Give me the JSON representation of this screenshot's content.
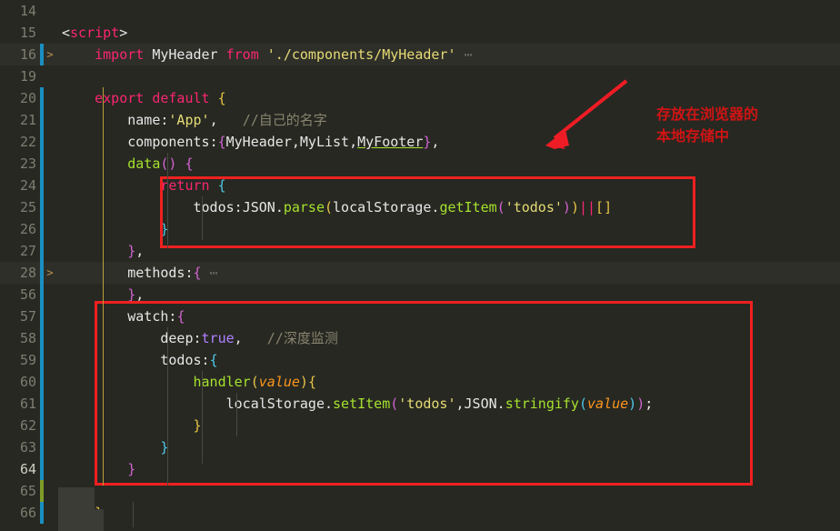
{
  "editor": {
    "background_color": "#272822",
    "annotation_color": "#f02020",
    "lines": [
      {
        "num": "14",
        "git": "none",
        "fold": "",
        "highlight": false,
        "text": ""
      },
      {
        "num": "15",
        "git": "none",
        "fold": "",
        "highlight": false,
        "text": "<script>"
      },
      {
        "num": "16",
        "git": "mod",
        "fold": ">",
        "highlight": true,
        "text": "    import MyHeader from './components/MyHeader' ⋯"
      },
      {
        "num": "19",
        "git": "none",
        "fold": "",
        "highlight": false,
        "text": ""
      },
      {
        "num": "20",
        "git": "mod",
        "fold": "",
        "highlight": false,
        "text": "    export default {"
      },
      {
        "num": "21",
        "git": "mod",
        "fold": "",
        "highlight": false,
        "text": "        name:'App',   //自己的名字"
      },
      {
        "num": "22",
        "git": "mod",
        "fold": "",
        "highlight": false,
        "text": "        components:{MyHeader,MyList,MyFooter},"
      },
      {
        "num": "23",
        "git": "mod",
        "fold": "",
        "highlight": false,
        "text": "        data() {"
      },
      {
        "num": "24",
        "git": "mod",
        "fold": "",
        "highlight": false,
        "text": "            return {"
      },
      {
        "num": "25",
        "git": "mod",
        "fold": "",
        "highlight": false,
        "text": "                todos:JSON.parse(localStorage.getItem('todos'))||[]"
      },
      {
        "num": "26",
        "git": "mod",
        "fold": "",
        "highlight": false,
        "text": "            }"
      },
      {
        "num": "27",
        "git": "mod",
        "fold": "",
        "highlight": false,
        "text": "        },"
      },
      {
        "num": "28",
        "git": "mod",
        "fold": ">",
        "highlight": true,
        "text": "        methods:{ ⋯"
      },
      {
        "num": "56",
        "git": "mod",
        "fold": "",
        "highlight": false,
        "text": "        },"
      },
      {
        "num": "57",
        "git": "mod",
        "fold": "",
        "highlight": false,
        "text": "        watch:{"
      },
      {
        "num": "58",
        "git": "mod",
        "fold": "",
        "highlight": false,
        "text": "            deep:true,   //深度监测"
      },
      {
        "num": "59",
        "git": "mod",
        "fold": "",
        "highlight": false,
        "text": "            todos:{"
      },
      {
        "num": "60",
        "git": "mod",
        "fold": "",
        "highlight": false,
        "text": "                handler(value){"
      },
      {
        "num": "61",
        "git": "mod",
        "fold": "",
        "highlight": false,
        "text": "                    localStorage.setItem('todos',JSON.stringify(value));"
      },
      {
        "num": "62",
        "git": "mod",
        "fold": "",
        "highlight": false,
        "text": "                }"
      },
      {
        "num": "63",
        "git": "mod",
        "fold": "",
        "highlight": false,
        "text": "            }"
      },
      {
        "num": "64",
        "git": "mod",
        "fold": "",
        "highlight": false,
        "text": "        }"
      },
      {
        "num": "65",
        "git": "add",
        "fold": "",
        "highlight": false,
        "text": ""
      },
      {
        "num": "66",
        "git": "mod",
        "fold": "",
        "highlight": false,
        "text": "    }"
      }
    ]
  },
  "annotations": {
    "note_storage": "存放在浏览器的\n本地存储中",
    "arrow_label": "arrow-pointing-to-return-block",
    "box_return_label": "highlight-box-return-localstorage",
    "box_watch_label": "highlight-box-watch-block"
  },
  "code_tokens": {
    "l15": [
      {
        "t": "<",
        "c": "punct"
      },
      {
        "t": "script",
        "c": "tag"
      },
      {
        "t": ">",
        "c": "punct"
      }
    ],
    "l16": [
      {
        "t": "    ",
        "c": "punct"
      },
      {
        "t": "import",
        "c": "kw"
      },
      {
        "t": " ",
        "c": "punct"
      },
      {
        "t": "MyHeader",
        "c": "ident"
      },
      {
        "t": " ",
        "c": "punct"
      },
      {
        "t": "from",
        "c": "kw"
      },
      {
        "t": " ",
        "c": "punct"
      },
      {
        "t": "'./components/MyHeader'",
        "c": "str"
      },
      {
        "t": " ⋯",
        "c": "dots"
      }
    ],
    "l20": [
      {
        "t": "    ",
        "c": "punct"
      },
      {
        "t": "export",
        "c": "kw"
      },
      {
        "t": " ",
        "c": "punct"
      },
      {
        "t": "default",
        "c": "kw"
      },
      {
        "t": " ",
        "c": "punct"
      },
      {
        "t": "{",
        "c": "br-y"
      }
    ],
    "l21": [
      {
        "t": "        ",
        "c": "punct"
      },
      {
        "t": "name",
        "c": "prop"
      },
      {
        "t": ":",
        "c": "punct"
      },
      {
        "t": "'App'",
        "c": "str"
      },
      {
        "t": ",   ",
        "c": "punct"
      },
      {
        "t": "//自己的名字",
        "c": "cmt"
      }
    ],
    "l22": [
      {
        "t": "        ",
        "c": "punct"
      },
      {
        "t": "components",
        "c": "prop"
      },
      {
        "t": ":",
        "c": "punct"
      },
      {
        "t": "{",
        "c": "br-p"
      },
      {
        "t": "MyHeader",
        "c": "ident"
      },
      {
        "t": ",",
        "c": "punct"
      },
      {
        "t": "MyList",
        "c": "ident"
      },
      {
        "t": ",",
        "c": "punct"
      },
      {
        "t": "MyFooter",
        "c": "ul-ident"
      },
      {
        "t": "}",
        "c": "br-p"
      },
      {
        "t": ",",
        "c": "punct"
      }
    ],
    "l23": [
      {
        "t": "        ",
        "c": "punct"
      },
      {
        "t": "data",
        "c": "fn"
      },
      {
        "t": "(",
        "c": "br-p"
      },
      {
        "t": ")",
        "c": "br-p"
      },
      {
        "t": " ",
        "c": "punct"
      },
      {
        "t": "{",
        "c": "br-p"
      }
    ],
    "l24": [
      {
        "t": "            ",
        "c": "punct"
      },
      {
        "t": "return",
        "c": "kw"
      },
      {
        "t": " ",
        "c": "punct"
      },
      {
        "t": "{",
        "c": "br-b"
      }
    ],
    "l25": [
      {
        "t": "                ",
        "c": "punct"
      },
      {
        "t": "todos",
        "c": "prop"
      },
      {
        "t": ":",
        "c": "punct"
      },
      {
        "t": "JSON",
        "c": "ident"
      },
      {
        "t": ".",
        "c": "punct"
      },
      {
        "t": "parse",
        "c": "fn"
      },
      {
        "t": "(",
        "c": "br-y"
      },
      {
        "t": "localStorage",
        "c": "ident"
      },
      {
        "t": ".",
        "c": "punct"
      },
      {
        "t": "getItem",
        "c": "fn"
      },
      {
        "t": "(",
        "c": "br-p"
      },
      {
        "t": "'todos'",
        "c": "str"
      },
      {
        "t": ")",
        "c": "br-p"
      },
      {
        "t": ")",
        "c": "br-y"
      },
      {
        "t": "||",
        "c": "op-or"
      },
      {
        "t": "[",
        "c": "br-y"
      },
      {
        "t": "]",
        "c": "br-y"
      }
    ],
    "l26": [
      {
        "t": "            ",
        "c": "punct"
      },
      {
        "t": "}",
        "c": "br-b"
      }
    ],
    "l27": [
      {
        "t": "        ",
        "c": "punct"
      },
      {
        "t": "}",
        "c": "br-p"
      },
      {
        "t": ",",
        "c": "punct"
      }
    ],
    "l28": [
      {
        "t": "        ",
        "c": "punct"
      },
      {
        "t": "methods",
        "c": "prop"
      },
      {
        "t": ":",
        "c": "punct"
      },
      {
        "t": "{",
        "c": "br-p"
      },
      {
        "t": " ⋯",
        "c": "dots"
      }
    ],
    "l56": [
      {
        "t": "        ",
        "c": "punct"
      },
      {
        "t": "}",
        "c": "br-p"
      },
      {
        "t": ",",
        "c": "punct"
      }
    ],
    "l57": [
      {
        "t": "        ",
        "c": "punct"
      },
      {
        "t": "watch",
        "c": "prop"
      },
      {
        "t": ":",
        "c": "punct"
      },
      {
        "t": "{",
        "c": "br-p"
      }
    ],
    "l58": [
      {
        "t": "            ",
        "c": "punct"
      },
      {
        "t": "deep",
        "c": "prop"
      },
      {
        "t": ":",
        "c": "punct"
      },
      {
        "t": "true",
        "c": "bool"
      },
      {
        "t": ",   ",
        "c": "punct"
      },
      {
        "t": "//深度监测",
        "c": "cmt"
      }
    ],
    "l59": [
      {
        "t": "            ",
        "c": "punct"
      },
      {
        "t": "todos",
        "c": "prop"
      },
      {
        "t": ":",
        "c": "punct"
      },
      {
        "t": "{",
        "c": "br-b"
      }
    ],
    "l60": [
      {
        "t": "                ",
        "c": "punct"
      },
      {
        "t": "handler",
        "c": "fn"
      },
      {
        "t": "(",
        "c": "br-y"
      },
      {
        "t": "value",
        "c": "param"
      },
      {
        "t": ")",
        "c": "br-y"
      },
      {
        "t": "{",
        "c": "br-y"
      }
    ],
    "l61": [
      {
        "t": "                    ",
        "c": "punct"
      },
      {
        "t": "localStorage",
        "c": "ident"
      },
      {
        "t": ".",
        "c": "punct"
      },
      {
        "t": "setItem",
        "c": "fn"
      },
      {
        "t": "(",
        "c": "br-p"
      },
      {
        "t": "'todos'",
        "c": "str"
      },
      {
        "t": ",",
        "c": "punct"
      },
      {
        "t": "JSON",
        "c": "ident"
      },
      {
        "t": ".",
        "c": "punct"
      },
      {
        "t": "stringify",
        "c": "fn"
      },
      {
        "t": "(",
        "c": "br-b"
      },
      {
        "t": "value",
        "c": "param"
      },
      {
        "t": ")",
        "c": "br-b"
      },
      {
        "t": ")",
        "c": "br-p"
      },
      {
        "t": ";",
        "c": "punct"
      }
    ],
    "l62": [
      {
        "t": "                ",
        "c": "punct"
      },
      {
        "t": "}",
        "c": "br-y"
      }
    ],
    "l63": [
      {
        "t": "            ",
        "c": "punct"
      },
      {
        "t": "}",
        "c": "br-b"
      }
    ],
    "l64": [
      {
        "t": "        ",
        "c": "punct"
      },
      {
        "t": "}",
        "c": "br-p"
      }
    ],
    "l66": [
      {
        "t": "    ",
        "c": "punct"
      },
      {
        "t": "}",
        "c": "br-y"
      }
    ]
  }
}
